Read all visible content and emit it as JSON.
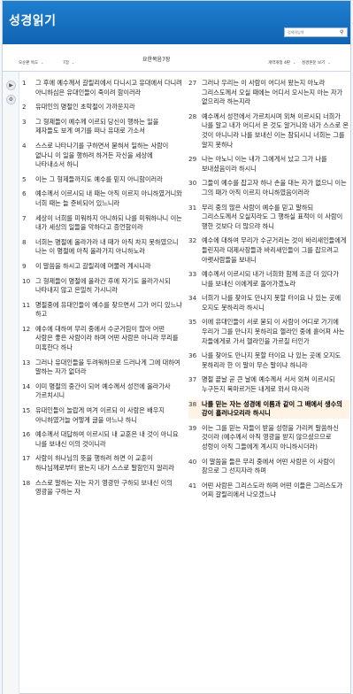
{
  "app": {
    "title": "성경읽기"
  },
  "search": {
    "placeholder": "검색어입력"
  },
  "toolbar": {
    "version": "오순판 독도",
    "chapter_select": "7장",
    "chapter_title": "요한복음7장",
    "right_1": "개역개정 4판",
    "right_2": "성경본문 보기"
  },
  "sidebar": {
    "btn1": "▶",
    "btn2": "⚙"
  },
  "verses_left": [
    {
      "n": "1",
      "t": "그 후에 예수께서 갈릴리에서 다니시고 유대에서 다니려 아니하심은 유대인들이 죽이려 함이러라"
    },
    {
      "n": "2",
      "t": "유대인의 명절인 초막절이 가까운지라"
    },
    {
      "n": "3",
      "t": "그 형제들이 예수께 이르되 당신이 행하는 일을 제자들도 보게 여기를 떠나 유대로 가소서"
    },
    {
      "n": "4",
      "t": "스스로 나타나기를 구하면서 묻혀서 일하는 사람이 없나니 이 일을 행하려 하거든 자신을 세상에 나타내소서 하니"
    },
    {
      "n": "5",
      "t": "이는 그 형제들까지도 예수를 믿지 아니함이러라"
    },
    {
      "n": "6",
      "t": "예수께서 이르시되 내 때는 아직 이르지 아니하였거니와 너희 때는 늘 준비되어 있느니라"
    },
    {
      "n": "7",
      "t": "세상이 너희를 미워하지 아니하되 나를 미워하나니 이는 내가 세상의 일들을 악하다고 증언함이라"
    },
    {
      "n": "8",
      "t": "너희는 명절에 올라가라 내 때가 아직 차지 못하였으니 나는 이 명절에 아직 올라가지 아니하노라"
    },
    {
      "n": "9",
      "t": "이 말씀을 하시고 갈릴리에 머물러 계시니라"
    },
    {
      "n": "10",
      "t": "그 형제들이 명절에 올라간 후에 자기도 올라가시되 나타내지 않고 은밀히 가시니라"
    },
    {
      "n": "11",
      "t": "명절중에 유대인들이 예수를 찾으면서 그가 어디 있느냐 하고"
    },
    {
      "n": "12",
      "t": "예수에 대하여 무리 중에서 수군거림이 많아 어떤 사람은 좋은 사람이라 하며 어떤 사람은 아니라 무리를 미혹한다 하나"
    },
    {
      "n": "13",
      "t": "그러나 유대인들을 두려워하므로 드러나게 그에 대하여 말하는 자가 없더라"
    },
    {
      "n": "14",
      "t": "이미 명절의 중간이 되어 예수께서 성전에 올라가사 가르치시니"
    },
    {
      "n": "15",
      "t": "유대인들이 놀랍게 여겨 이르되 이 사람은 배우지 아니하였거늘 어떻게 글을 아느냐 하니"
    },
    {
      "n": "16",
      "t": "예수께서 대답하여 이르시되 내 교훈은 내 것이 아니요 나를 보내신 이의 것이니라"
    },
    {
      "n": "17",
      "t": "사람이 하나님의 뜻을 행하려 하면 이 교훈이 하나님께로부터 왔는지 내가 스스로 말함인지 알리라"
    },
    {
      "n": "18",
      "t": "스스로 말하는 자는 자기 영광만 구하되 보내신 이의 영광을 구하는 자"
    }
  ],
  "verses_right": [
    {
      "n": "27",
      "t": "그러나 우리는 이 사람이 어디서 왔는지 아노라 그리스도께서 오실 때에는 어디서 오시는지 아는 자가 없으리라 하는지라"
    },
    {
      "n": "28",
      "t": "예수께서 성전에서 가르치시며 외쳐 이르시되 너희가 나를 알고 내가 어디서 온 것도 알거니와 내가 스스로 온 것이 아니니라 나를 보내신 이는 참되시니 너희는 그를 알지 못하나"
    },
    {
      "n": "29",
      "t": "나는 아노니 이는 내가 그에게서 났고 그가 나를 보내셨음이라 하시니"
    },
    {
      "n": "30",
      "t": "그들이 예수를 잡고자 하나 손을 대는 자가 없으니 이는 그의 때가 아직 이르지 아니하였음이러라"
    },
    {
      "n": "31",
      "t": "무리 중의 많은 사람이 예수를 믿고 말하되 그리스도께서 오실지라도 그 행하실 표적이 이 사람이 행한 것보다 더 많으랴 하니"
    },
    {
      "n": "32",
      "t": "예수에 대하여 무리가 수군거리는 것이 바리새인들에게 들린지라 대제사장들과 바리새인들이 그를 잡으려고 아랫사람들을 보내니"
    },
    {
      "n": "33",
      "t": "예수께서 이르시되 내가 너희와 함께 조금 더 있다가 나를 보내신 이에게로 돌아가겠노라"
    },
    {
      "n": "34",
      "t": "너희가 나를 찾아도 만나지 못할 터이요 나 있는 곳에 오지도 못하리라 하시니"
    },
    {
      "n": "35",
      "t": "이에 유대인들이 서로 묻되 이 사람이 어디로 가기에 우리가 그를 만나지 못하리요 헬라인 중에 흩어져 사는 자들에게로 가서 헬라인을 가르칠 터인가"
    },
    {
      "n": "36",
      "t": "나를 찾아도 만나지 못할 터이요 나 있는 곳에 오지도 못하리라 한 이 말이 무슨 말이냐 하니라"
    },
    {
      "n": "37",
      "t": "명절 끝날 곧 큰 날에 예수께서 서서 외쳐 이르시되 누구든지 목마르거든 내게로 와서 마시라"
    },
    {
      "n": "38",
      "t": "나를 믿는 자는 성경에 이름과 같이 그 배에서 생수의 강이 흘러나오리라 하시니",
      "highlight": true
    },
    {
      "n": "39",
      "t": "이는 그를 믿는 자들이 받을 성령을 가리켜 말씀하신 것이라 (예수께서 아직 영광을 받지 않으셨으므로 성령이 아직 그들에게 계시지 아니하시더라)"
    },
    {
      "n": "40",
      "t": "이 말씀을 들은 무리 중에서 어떤 사람은 이 사람이 참으로 그 선지자라 하며"
    },
    {
      "n": "41",
      "t": "어떤 사람은 그리스도라 하며 어떤 이들은 그리스도가 어찌 갈릴리에서 나오겠느냐"
    }
  ]
}
